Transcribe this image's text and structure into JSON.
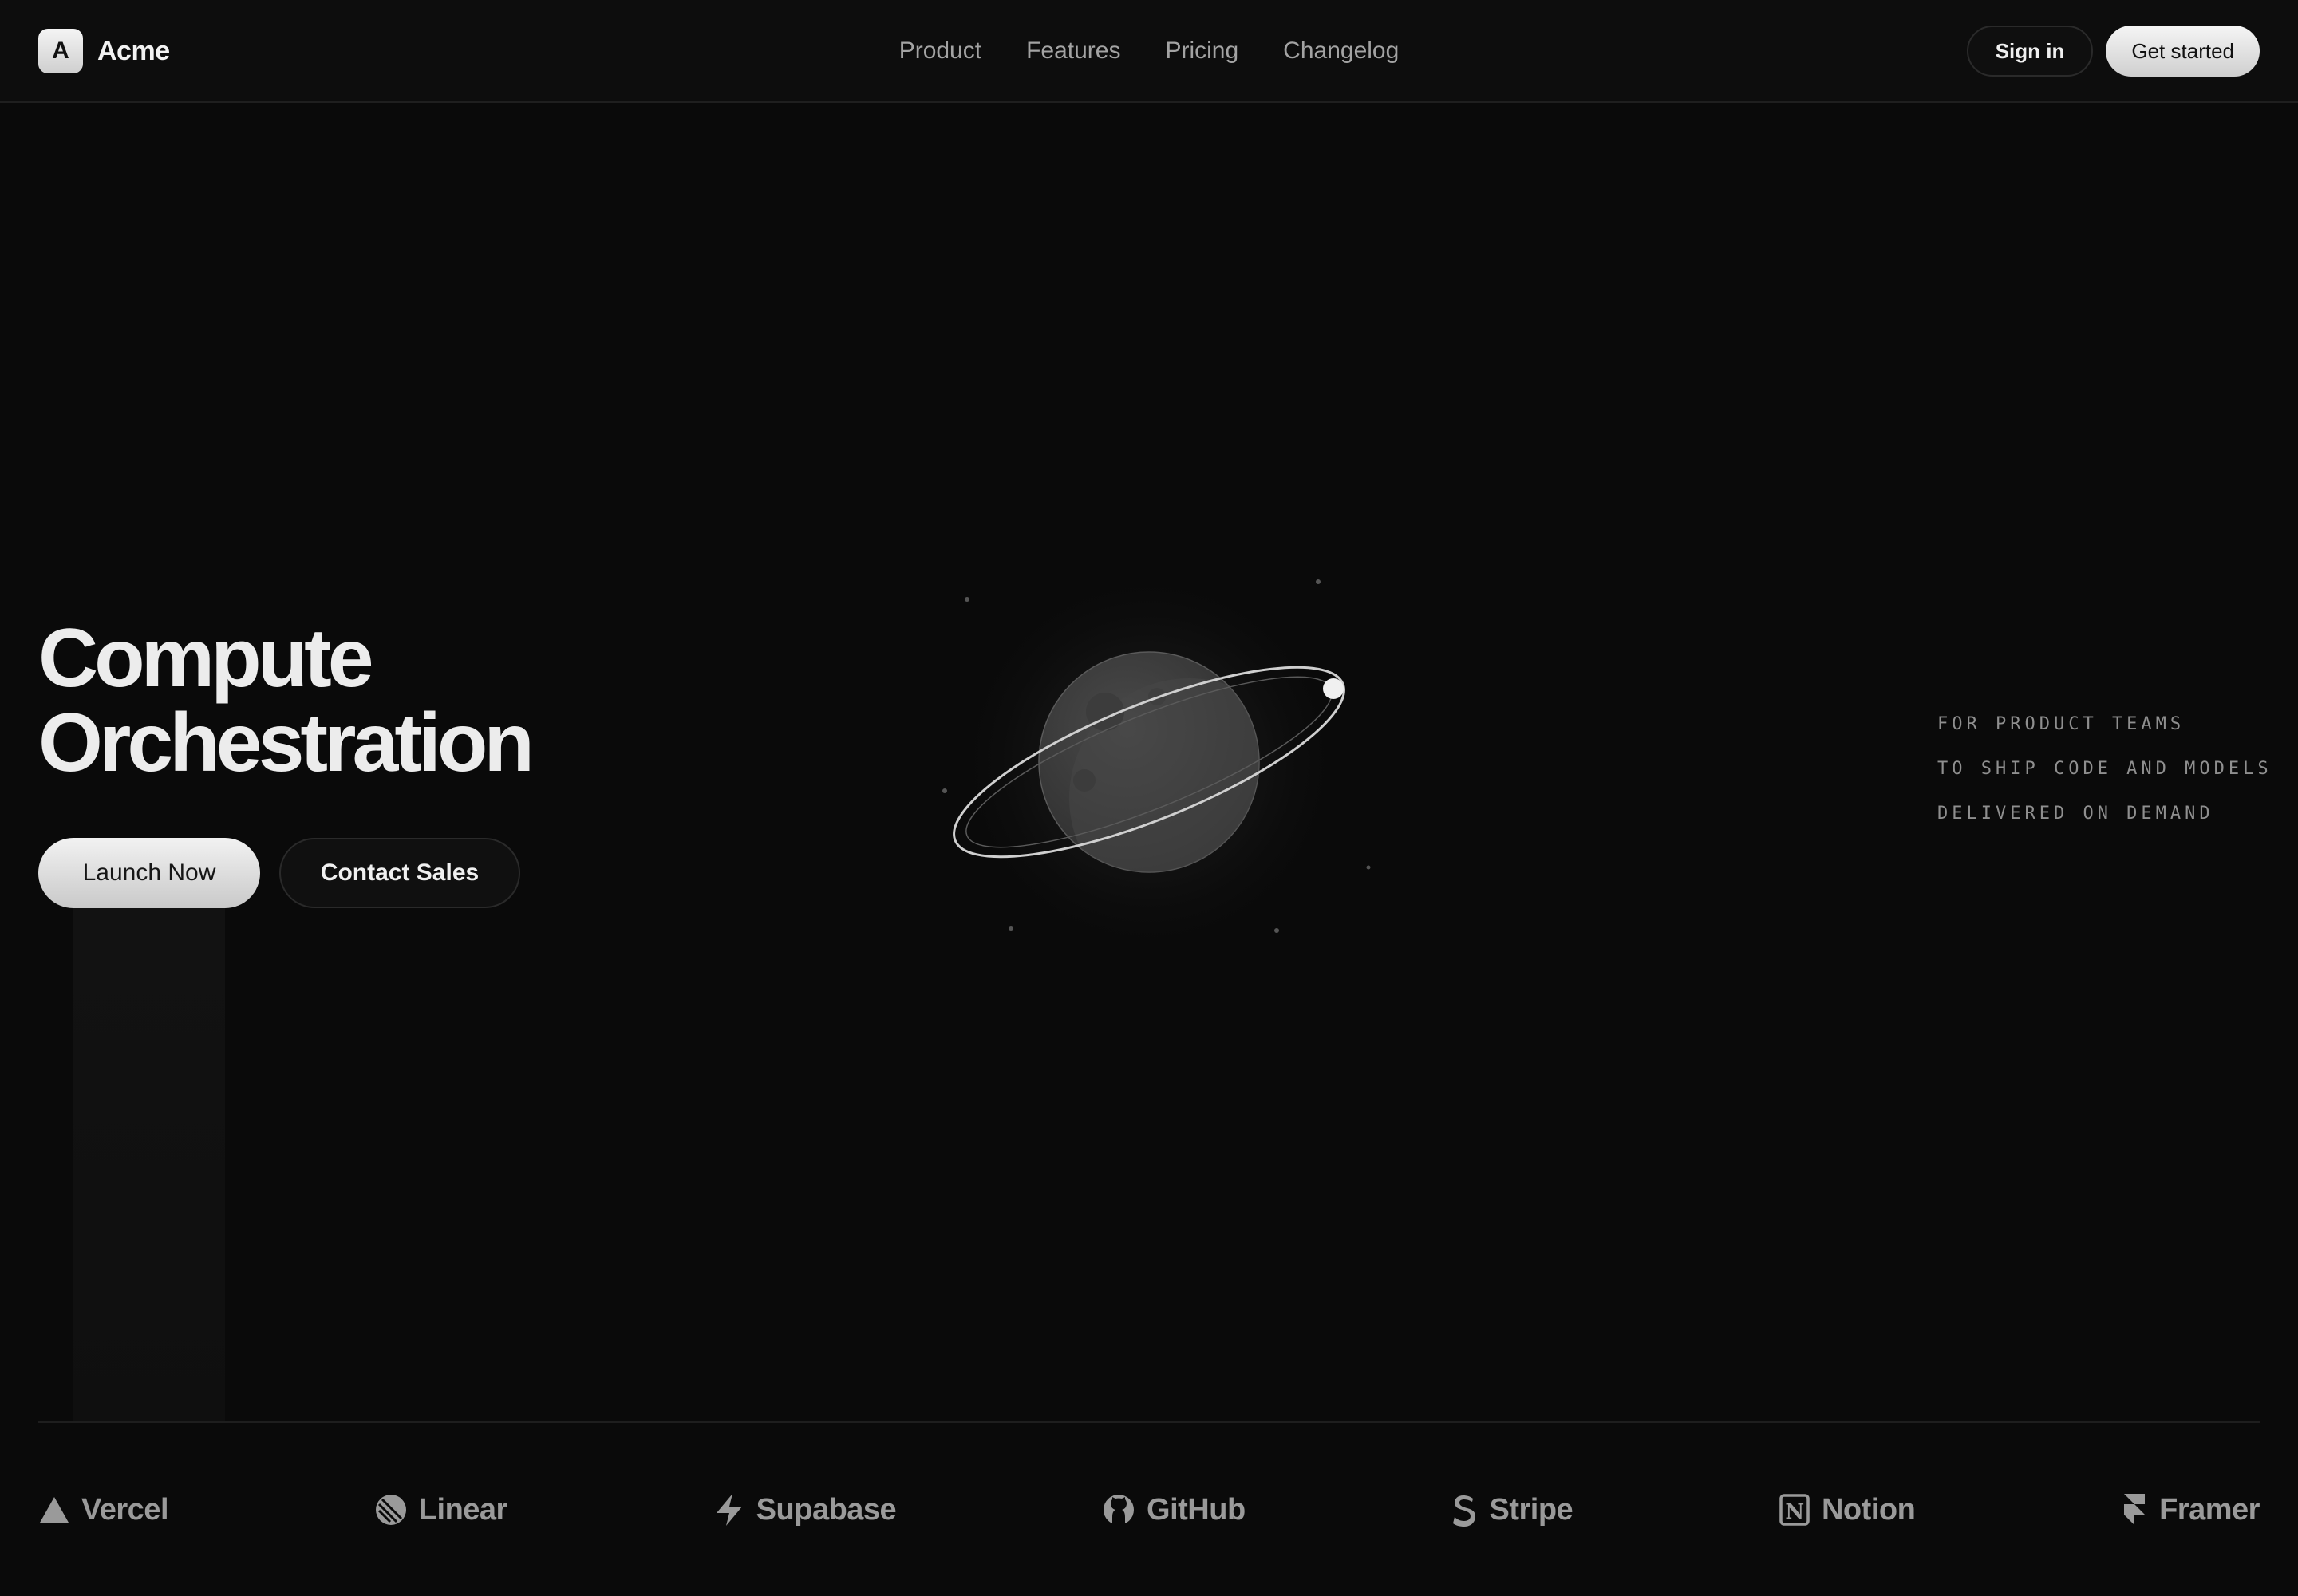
{
  "brand": {
    "logo_letter": "A",
    "name": "Acme"
  },
  "nav": {
    "links": [
      "Product",
      "Features",
      "Pricing",
      "Changelog"
    ],
    "sign_in": "Sign in",
    "get_started": "Get started"
  },
  "hero": {
    "title_line1": "Compute",
    "title_line2": "Orchestration",
    "primary_cta": "Launch Now",
    "secondary_cta": "Contact Sales",
    "illustration_icon": "planet-icon"
  },
  "tagline": {
    "lines": [
      "FOR PRODUCT TEAMS",
      "TO SHIP CODE AND MODELS",
      "DELIVERED ON DEMAND"
    ]
  },
  "logos": [
    {
      "name": "Vercel",
      "icon": "vercel-icon"
    },
    {
      "name": "Linear",
      "icon": "linear-icon"
    },
    {
      "name": "Supabase",
      "icon": "supabase-icon"
    },
    {
      "name": "GitHub",
      "icon": "github-icon"
    },
    {
      "name": "Stripe",
      "icon": "stripe-icon"
    },
    {
      "name": "Notion",
      "icon": "notion-icon"
    },
    {
      "name": "Framer",
      "icon": "framer-icon"
    }
  ],
  "colors": {
    "background": "#0a0a0a",
    "text": "#ededed",
    "muted": "#a3a3a3"
  }
}
